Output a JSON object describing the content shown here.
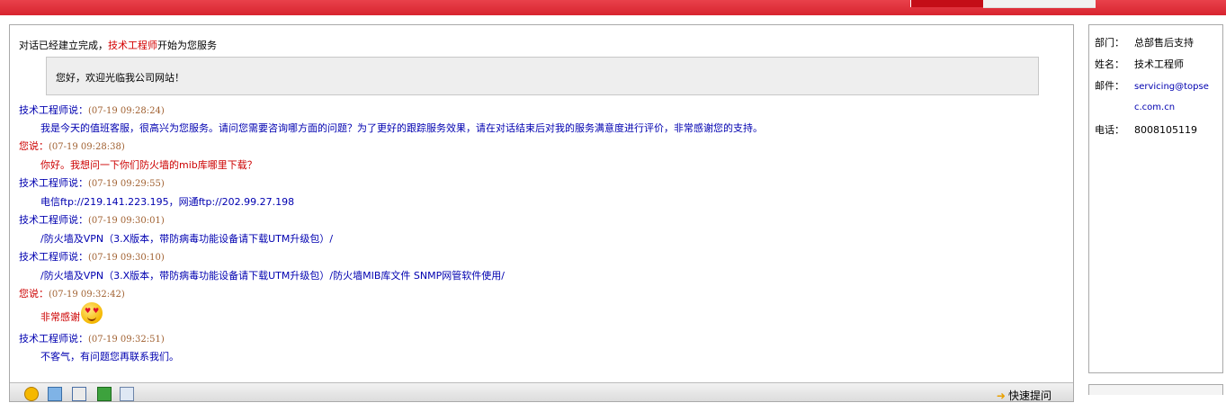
{
  "header": {
    "tab_active": "",
    "tab_other": ""
  },
  "chat": {
    "connected_prefix": "对话已经建立完成，",
    "connected_agent": "技术工程师",
    "connected_suffix": "开始为您服务",
    "welcome": "您好，欢迎光临我公司网站！",
    "messages": [
      {
        "speaker": "技术工程师说：",
        "time": "(07-19 09:28:24)",
        "text": "我是今天的值班客服，很高兴为您服务。请问您需要咨询哪方面的问题？为了更好的跟踪服务效果，请在对话结束后对我的服务满意度进行评价，非常感谢您的支持。"
      },
      {
        "speaker": "您说：",
        "time": "(07-19 09:28:38)",
        "text": "你好。我想问一下你们防火墙的mib库哪里下载？"
      },
      {
        "speaker": "技术工程师说：",
        "time": "(07-19 09:29:55)",
        "text": "电信ftp://219.141.223.195，网通ftp://202.99.27.198"
      },
      {
        "speaker": "技术工程师说：",
        "time": "(07-19 09:30:01)",
        "text": "/防火墙及VPN（3.X版本，带防病毒功能设备请下载UTM升级包）/"
      },
      {
        "speaker": "技术工程师说：",
        "time": "(07-19 09:30:10)",
        "text": "/防火墙及VPN（3.X版本，带防病毒功能设备请下载UTM升级包）/防火墙MIB库文件 SNMP网管软件使用/"
      },
      {
        "speaker": "您说：",
        "time": "(07-19 09:32:42)",
        "text": "非常感谢"
      },
      {
        "speaker": "技术工程师说：",
        "time": "(07-19 09:32:51)",
        "text": "不客气，有问题您再联系我们。"
      }
    ]
  },
  "toolbar": {
    "quick_ask": "快速提问"
  },
  "info": {
    "dept_label": "部门：",
    "dept_value": "总部售后支持",
    "name_label": "姓名：",
    "name_value": "技术工程师",
    "email_label": "邮件：",
    "email_line1": "servicing@topse",
    "email_line2": "c.com.cn",
    "phone_label": "电话：",
    "phone_value": "8008105119"
  },
  "colors": {
    "topbar": "#e0303a",
    "agent": "#0000b0",
    "user": "#cc0000"
  },
  "icons": [
    "emoji-icon",
    "image-icon",
    "screenshot-icon",
    "translate-icon",
    "history-icon",
    "arrow-right-icon",
    "love-eyes-emoji"
  ]
}
